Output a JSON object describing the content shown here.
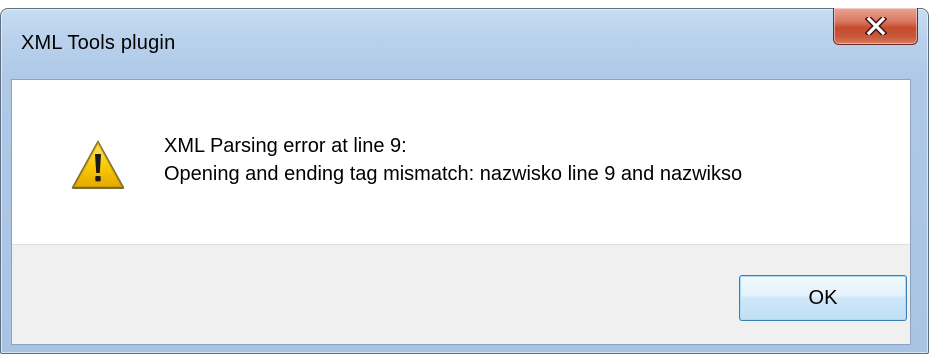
{
  "dialog": {
    "title": "XML Tools plugin",
    "message_line1": "XML Parsing error at line 9:",
    "message_line2": "Opening and ending tag mismatch: nazwisko line 9 and nazwikso",
    "icon": "warning-icon",
    "ok_label": "OK",
    "close_icon": "close-icon"
  },
  "colors": {
    "frame": "#b9d1ec",
    "close_button": "#c44b2f",
    "warning": "#f5c400",
    "button_bar": "#f0f0f0",
    "ok_border": "#3c7fb1"
  }
}
